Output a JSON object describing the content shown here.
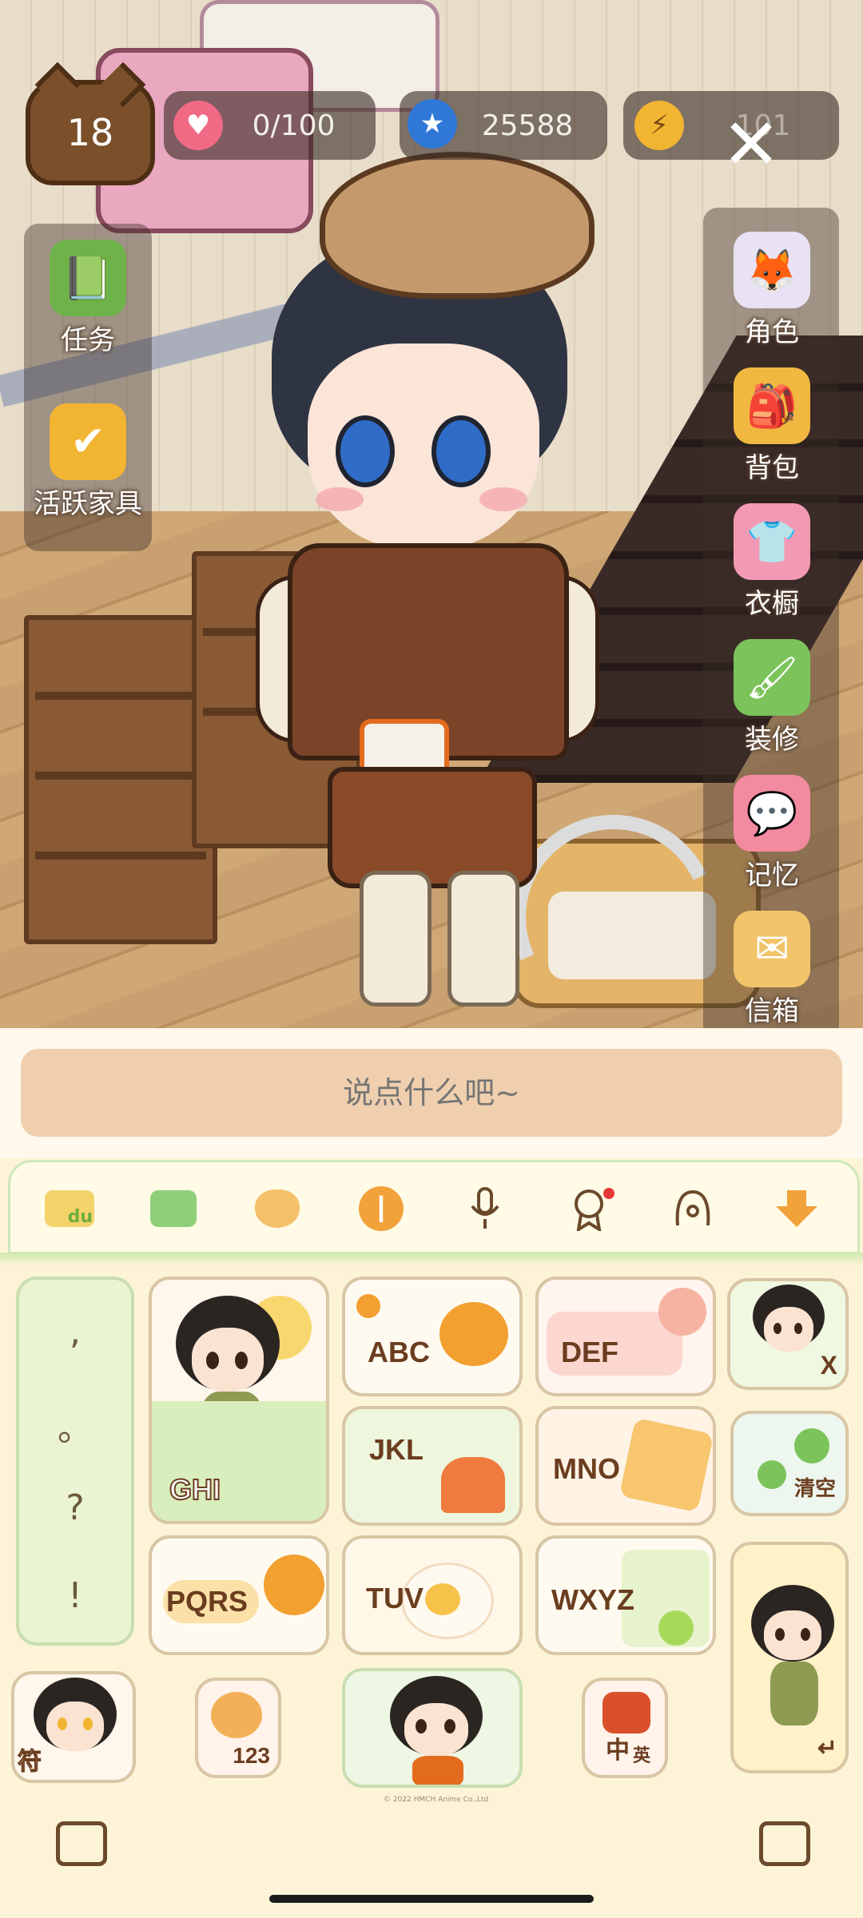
{
  "hud": {
    "level": "18",
    "hearts": "0/100",
    "stars": "25588",
    "energy": "101",
    "close_symbol": "✕"
  },
  "left_menu": [
    {
      "label": "任务",
      "icon": "task-book-icon"
    },
    {
      "label": "活跃家具",
      "icon": "calendar-check-icon"
    }
  ],
  "right_menu": [
    {
      "label": "角色",
      "icon": "character-fox-icon"
    },
    {
      "label": "背包",
      "icon": "backpack-icon"
    },
    {
      "label": "衣橱",
      "icon": "wardrobe-shirt-icon"
    },
    {
      "label": "装修",
      "icon": "paint-roller-icon"
    },
    {
      "label": "记忆",
      "icon": "memory-chat-icon"
    },
    {
      "label": "信箱",
      "icon": "mailbox-envelope-icon"
    }
  ],
  "chat": {
    "placeholder": "说点什么吧~"
  },
  "toolbar": {
    "logo_text": "du",
    "items": [
      "du-logo-icon",
      "layout-icon",
      "cat-face-icon",
      "voice-wave-icon",
      "microphone-icon",
      "badge-ai-icon",
      "pen-a-icon",
      "collapse-arrow-icon"
    ],
    "notification_color": "#e53935"
  },
  "keyboard": {
    "punctuation": [
      ",",
      "。",
      "?",
      "!"
    ],
    "keys": {
      "abc": "ABC",
      "def": "DEF",
      "ghi": "GHI",
      "jkl": "JKL",
      "mno": "MNO",
      "pqrs": "PQRS",
      "tuv": "TUV",
      "wxyz": "WXYZ",
      "delete": "X",
      "clear": "清空",
      "symbols": "符",
      "num": "123",
      "lang_cn": "中",
      "lang_en": "英",
      "enter": "↵"
    },
    "copyright": "© 2022 HMCH Anime Co.,Ltd"
  },
  "colors": {
    "chat_bg": "#efcfae",
    "keyboard_bg": "#fdf4d8",
    "key_text": "#6b3d1f",
    "hud_bg": "#3c2d28"
  }
}
